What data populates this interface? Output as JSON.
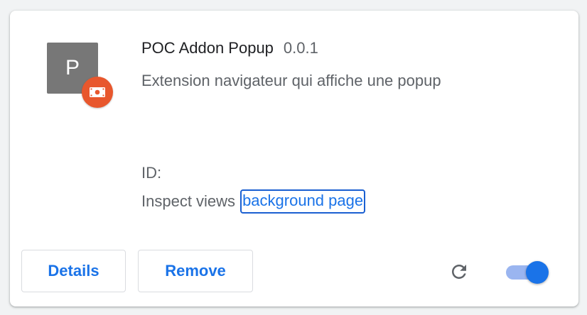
{
  "extension": {
    "icon_letter": "P",
    "name": "POC Addon Popup",
    "version": "0.0.1",
    "description": "Extension navigateur qui affiche une popup",
    "id_label": "ID:",
    "inspect_label": "Inspect views",
    "background_link": "background page",
    "enabled": true
  },
  "actions": {
    "details_label": "Details",
    "remove_label": "Remove"
  },
  "icons": {
    "badge": "unpacked-extension-icon",
    "reload": "reload-icon",
    "toggle": "enable-toggle"
  },
  "colors": {
    "accent": "#1a73e8",
    "badge": "#e8572d",
    "icon_bg": "#777777",
    "toggle_track": "#9ab5f0"
  }
}
